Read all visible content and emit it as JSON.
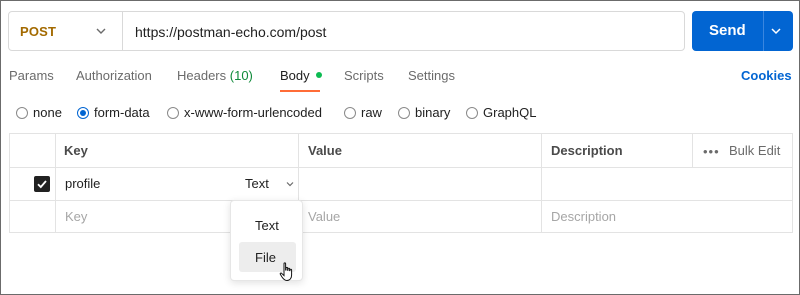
{
  "request": {
    "method": "POST",
    "url": "https://postman-echo.com/post",
    "send_label": "Send"
  },
  "tabs": [
    {
      "label": "Params"
    },
    {
      "label": "Authorization"
    },
    {
      "label": "Headers",
      "count": "(10)"
    },
    {
      "label": "Body"
    },
    {
      "label": "Scripts"
    },
    {
      "label": "Settings"
    }
  ],
  "cookies_label": "Cookies",
  "body_types": [
    "none",
    "form-data",
    "x-www-form-urlencoded",
    "raw",
    "binary",
    "GraphQL"
  ],
  "selected_body_type": "form-data",
  "table": {
    "headers": {
      "key": "Key",
      "value": "Value",
      "description": "Description",
      "bulk_edit": "Bulk Edit",
      "more": "•••"
    },
    "row": {
      "key": "profile",
      "type": "Text"
    },
    "placeholders": {
      "key": "Key",
      "value": "Value",
      "description": "Description"
    }
  },
  "type_menu": {
    "options": [
      "Text",
      "File"
    ],
    "hovered": "File"
  },
  "colors": {
    "method": "#a36a00",
    "accent": "#0265d2",
    "active_tab_underline": "#ff6c37",
    "body_dot": "#0cbb52",
    "header_count": "#0f8a3a"
  },
  "icons": {
    "method_chevron": "chevron-down-icon",
    "send_chevron": "chevron-down-icon",
    "type_chevron": "chevron-down-icon",
    "checkbox": "check-icon",
    "cursor": "hand-pointer-icon"
  }
}
